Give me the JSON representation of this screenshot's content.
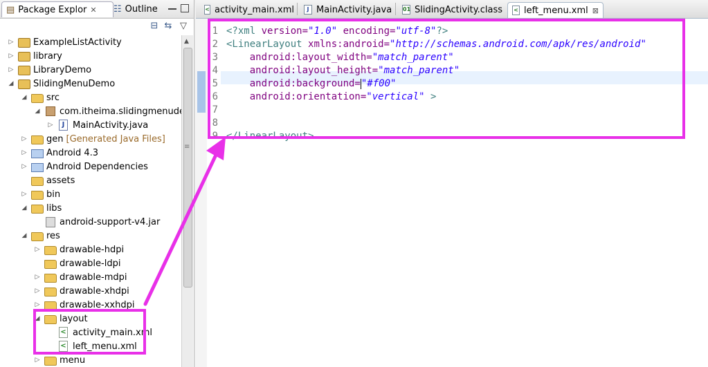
{
  "left_panel": {
    "tabs": {
      "package_explorer": "Package Explor",
      "outline": "Outline"
    },
    "tree": [
      {
        "depth": 0,
        "twisty": "right",
        "icon": "project",
        "label": "ExampleListActivity"
      },
      {
        "depth": 0,
        "twisty": "right",
        "icon": "project",
        "label": "library"
      },
      {
        "depth": 0,
        "twisty": "right",
        "icon": "project",
        "label": "LibraryDemo"
      },
      {
        "depth": 0,
        "twisty": "down",
        "icon": "project",
        "label": "SlidingMenuDemo"
      },
      {
        "depth": 1,
        "twisty": "down",
        "icon": "folder",
        "label": "src"
      },
      {
        "depth": 2,
        "twisty": "down",
        "icon": "package",
        "label": "com.itheima.slidingmenudemo"
      },
      {
        "depth": 3,
        "twisty": "right",
        "icon": "java",
        "label": "MainActivity.java"
      },
      {
        "depth": 1,
        "twisty": "right",
        "icon": "folder",
        "label": "gen",
        "extra": "[Generated Java Files]"
      },
      {
        "depth": 1,
        "twisty": "right",
        "icon": "library",
        "label": "Android 4.3"
      },
      {
        "depth": 1,
        "twisty": "right",
        "icon": "library",
        "label": "Android Dependencies"
      },
      {
        "depth": 1,
        "twisty": "",
        "icon": "folder",
        "label": "assets"
      },
      {
        "depth": 1,
        "twisty": "right",
        "icon": "folder",
        "label": "bin"
      },
      {
        "depth": 1,
        "twisty": "down",
        "icon": "folder",
        "label": "libs"
      },
      {
        "depth": 2,
        "twisty": "",
        "icon": "jar",
        "label": "android-support-v4.jar"
      },
      {
        "depth": 1,
        "twisty": "down",
        "icon": "folder",
        "label": "res"
      },
      {
        "depth": 2,
        "twisty": "right",
        "icon": "folder",
        "label": "drawable-hdpi"
      },
      {
        "depth": 2,
        "twisty": "",
        "icon": "folder",
        "label": "drawable-ldpi"
      },
      {
        "depth": 2,
        "twisty": "right",
        "icon": "folder",
        "label": "drawable-mdpi"
      },
      {
        "depth": 2,
        "twisty": "right",
        "icon": "folder",
        "label": "drawable-xhdpi"
      },
      {
        "depth": 2,
        "twisty": "right",
        "icon": "folder",
        "label": "drawable-xxhdpi"
      },
      {
        "depth": 2,
        "twisty": "down",
        "icon": "folder",
        "label": "layout"
      },
      {
        "depth": 3,
        "twisty": "",
        "icon": "xml",
        "label": "activity_main.xml"
      },
      {
        "depth": 3,
        "twisty": "",
        "icon": "xml",
        "label": "left_menu.xml"
      },
      {
        "depth": 2,
        "twisty": "right",
        "icon": "folder",
        "label": "menu"
      }
    ]
  },
  "editor": {
    "tabs": [
      {
        "label": "activity_main.xml",
        "icon": "xml",
        "active": false
      },
      {
        "label": "MainActivity.java",
        "icon": "java",
        "active": false
      },
      {
        "label": "SlidingActivity.class",
        "icon": "class",
        "active": false
      },
      {
        "label": "left_menu.xml",
        "icon": "xml",
        "active": true
      }
    ],
    "lines": [
      {
        "num": "1",
        "tokens": [
          {
            "t": "<?xml ",
            "c": "tag"
          },
          {
            "t": "version=",
            "c": "attr"
          },
          {
            "t": "\"1.0\"",
            "c": "val"
          },
          {
            "t": " encoding=",
            "c": "attr"
          },
          {
            "t": "\"utf-8\"",
            "c": "val"
          },
          {
            "t": "?>",
            "c": "tag"
          }
        ]
      },
      {
        "num": "2",
        "tokens": [
          {
            "t": "<LinearLayout ",
            "c": "tag"
          },
          {
            "t": "xmlns:android=",
            "c": "attr"
          },
          {
            "t": "\"http://schemas.android.com/apk/res/android\"",
            "c": "val"
          }
        ]
      },
      {
        "num": "3",
        "tokens": [
          {
            "t": "    android:layout_width=",
            "c": "attr"
          },
          {
            "t": "\"match_parent\"",
            "c": "val"
          }
        ]
      },
      {
        "num": "4",
        "tokens": [
          {
            "t": "    android:layout_height=",
            "c": "attr"
          },
          {
            "t": "\"match_parent\"",
            "c": "val"
          }
        ]
      },
      {
        "num": "5",
        "tokens": [
          {
            "t": "    android:background=",
            "c": "attr"
          },
          {
            "t": "\"#f00\"",
            "c": "val"
          }
        ]
      },
      {
        "num": "6",
        "tokens": [
          {
            "t": "    android:orientation=",
            "c": "attr"
          },
          {
            "t": "\"vertical\"",
            "c": "val"
          },
          {
            "t": " >",
            "c": "tag"
          }
        ]
      },
      {
        "num": "7",
        "tokens": []
      },
      {
        "num": "8",
        "tokens": []
      },
      {
        "num": "9",
        "tokens": [
          {
            "t": "</LinearLayout>",
            "c": "tag"
          }
        ]
      }
    ]
  },
  "colors": {
    "annotation": "#e830e8",
    "xml_tag": "#3f7f7f",
    "xml_attr": "#7f007f",
    "xml_value": "#2a00ff"
  }
}
